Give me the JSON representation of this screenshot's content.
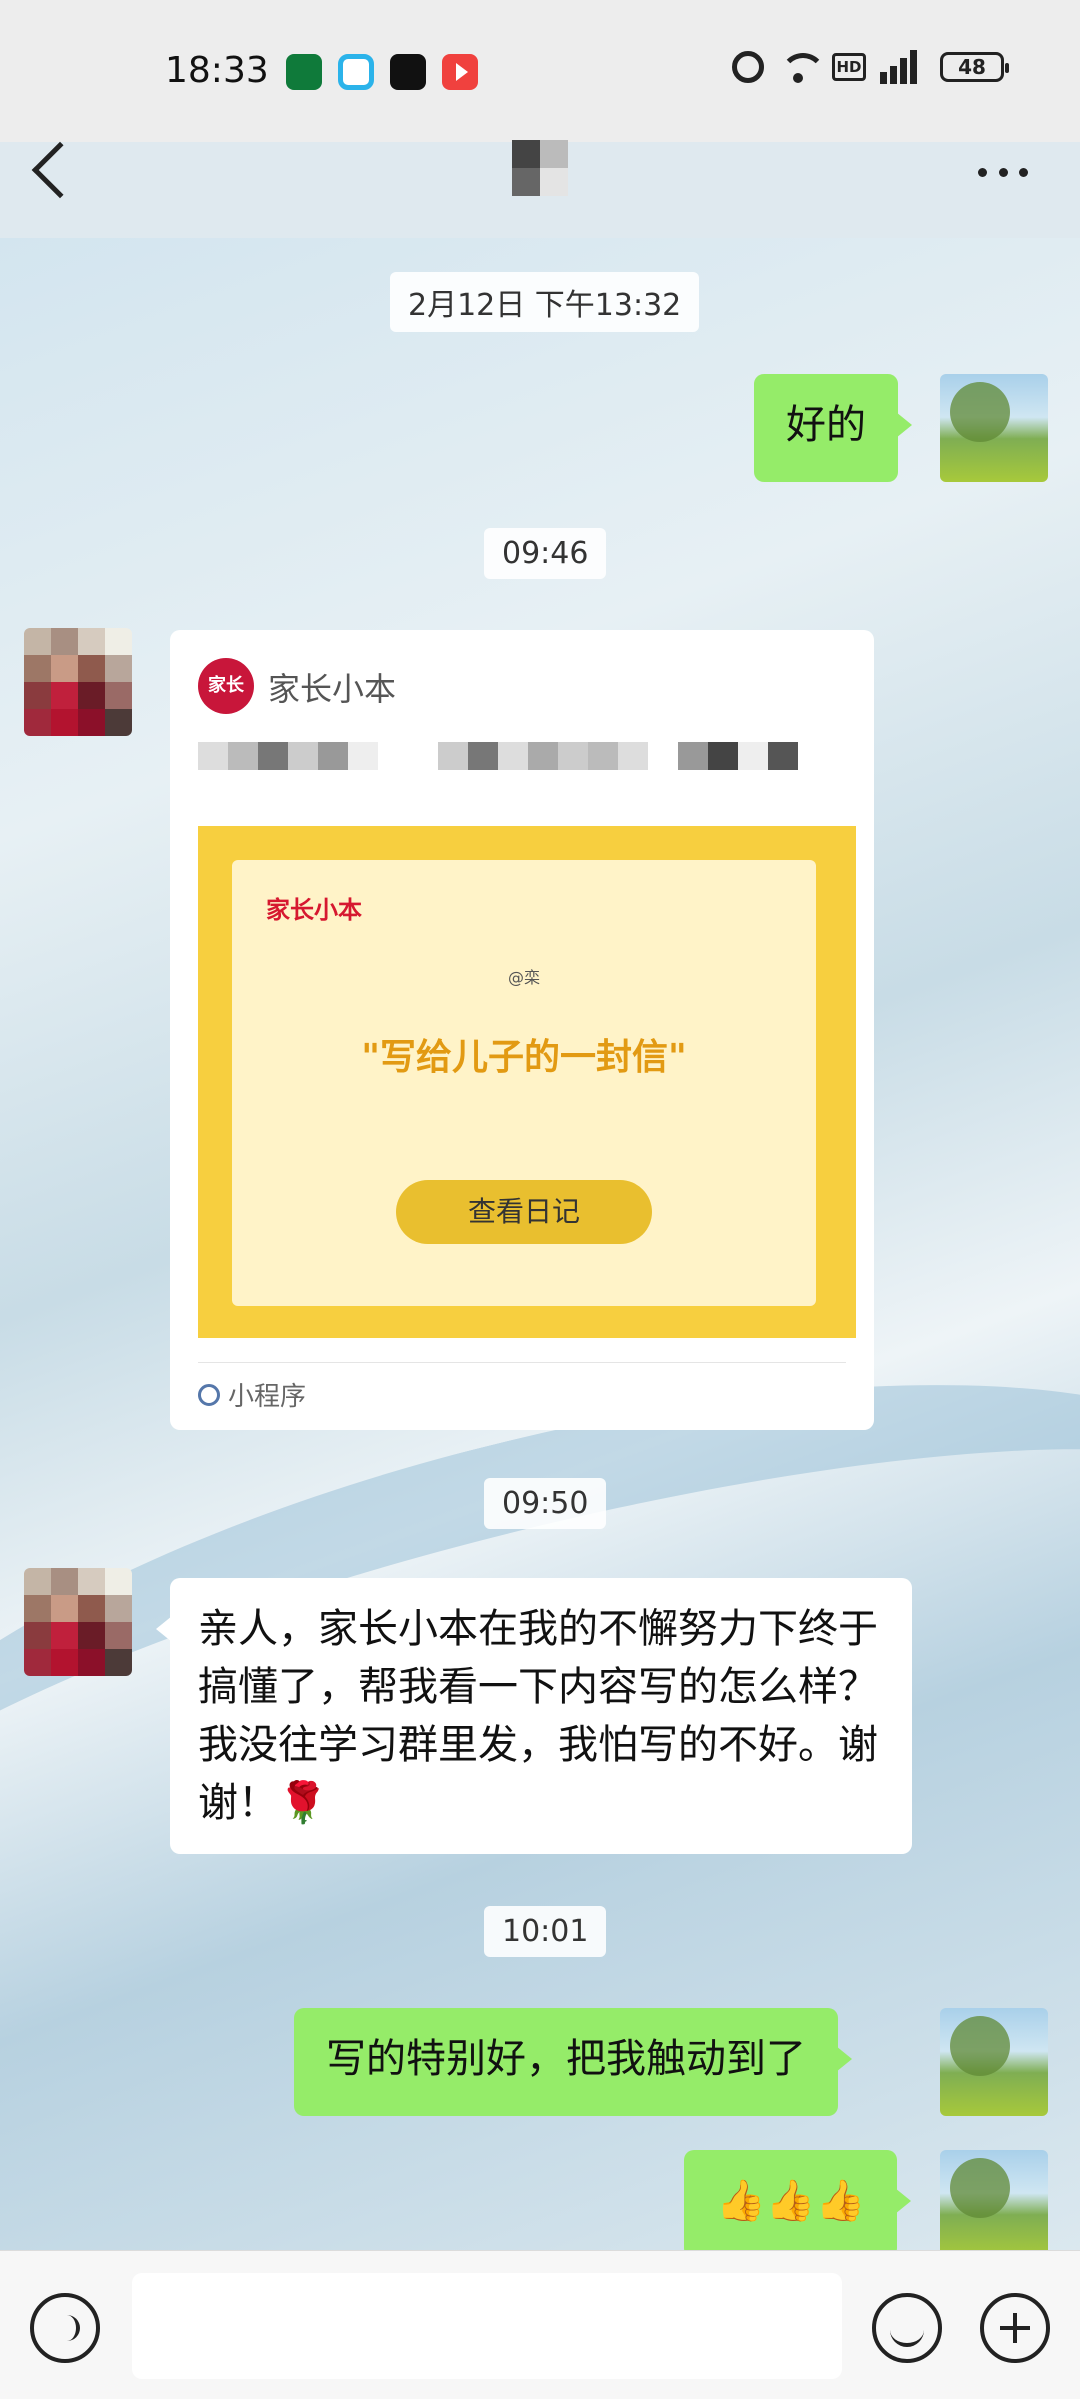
{
  "status_bar": {
    "time": "18:33",
    "battery": "48",
    "network": "4G",
    "icons": [
      "oppo-app-icon",
      "video-app-icon",
      "tiktok-icon",
      "play-app-icon",
      "alarm-icon",
      "wifi-icon",
      "hd-icon",
      "signal-icon",
      "battery-icon"
    ]
  },
  "header": {
    "title": "",
    "back_icon": "chevron-left-icon",
    "more_icon": "more-dots-icon"
  },
  "messages": [
    {
      "type": "timestamp",
      "text": "2月12日 下午13:32"
    },
    {
      "type": "text",
      "sender": "self",
      "text": "好的"
    },
    {
      "type": "timestamp",
      "text": "09:46"
    },
    {
      "type": "mini_program",
      "sender": "other",
      "app_name": "家长小本",
      "logo_text": "家长",
      "brand": "家长小本",
      "at": "@栾",
      "quote": "\"写给儿子的一封信\"",
      "button": "查看日记",
      "footer": "小程序"
    },
    {
      "type": "timestamp",
      "text": "09:50"
    },
    {
      "type": "text",
      "sender": "other",
      "text": "亲人，家长小本在我的不懈努力下终于搞懂了，帮我看一下内容写的怎么样？我没往学习群里发，我怕写的不好。谢谢！🌹"
    },
    {
      "type": "timestamp",
      "text": "10:01"
    },
    {
      "type": "text",
      "sender": "self",
      "text": "写的特别好，把我触动到了"
    },
    {
      "type": "text",
      "sender": "self",
      "text": "👍👍👍"
    }
  ],
  "input_bar": {
    "placeholder": "",
    "voice_icon": "voice-icon",
    "emoji_icon": "emoji-icon",
    "plus_icon": "plus-icon"
  },
  "colors": {
    "self_bubble": "#95ec69",
    "other_bubble": "#ffffff",
    "header_bg": "#ededed",
    "card_banner": "#f7cf3f",
    "card_brand": "#d6182f",
    "card_quote": "#e29a13"
  }
}
